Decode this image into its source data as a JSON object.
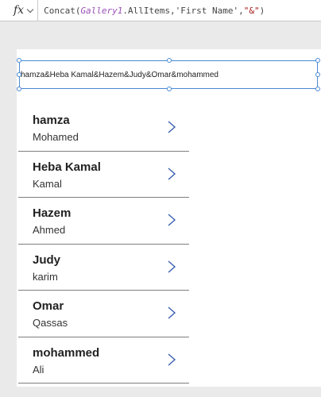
{
  "formula_bar": {
    "fx_label": "fx",
    "formula": {
      "fn": "Concat(",
      "ctrl": "Gallery1",
      "rest": ".AllItems,'First Name',",
      "str": "\"&\"",
      "close": ")"
    }
  },
  "label": {
    "text": "hamza&Heba Kamal&Hazem&Judy&Omar&mohammed"
  },
  "gallery": {
    "items": [
      {
        "title": "hamza",
        "subtitle": "Mohamed"
      },
      {
        "title": "Heba Kamal",
        "subtitle": "Kamal"
      },
      {
        "title": "Hazem",
        "subtitle": "Ahmed"
      },
      {
        "title": "Judy",
        "subtitle": "karim"
      },
      {
        "title": "Omar",
        "subtitle": "Qassas"
      },
      {
        "title": "mohammed",
        "subtitle": "Ali"
      }
    ]
  },
  "colors": {
    "selection": "#4a8ad4",
    "chevron": "#3a5fb0",
    "control_ref": "#9b4fb8",
    "string": "#a31515"
  }
}
